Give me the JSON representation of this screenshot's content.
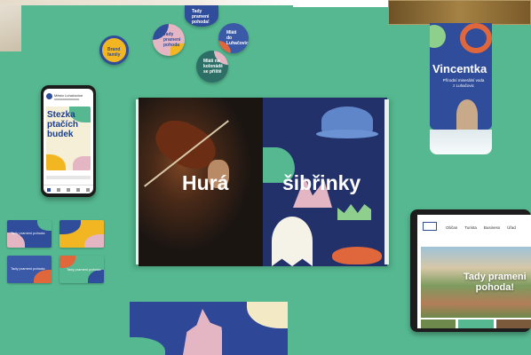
{
  "stickers": [
    {
      "text": "Brand\nfamily",
      "bg": "#f2b623"
    },
    {
      "text": "Tady\nprameni\npohoda!",
      "bg": "#2f4d9a"
    },
    {
      "text": "Tady\nprameni\npohoda",
      "bg": "#e4b6c4"
    },
    {
      "text": "Mláti\ndo\nLuhačovic",
      "bg": "#3a5aa8"
    },
    {
      "text": "Mláti na\nkolonádě\nse přiště",
      "bg": "#2d6e67"
    }
  ],
  "phone": {
    "app_header": "Město Luhačovice",
    "card_title": "Stezka\nptačích\nbudek"
  },
  "book": {
    "left_text": "Hurá",
    "right_text": "šibřinky"
  },
  "bottle": {
    "brand": "Vincentka",
    "subtitle": "Přírodní minerální voda\nz Luhačovic"
  },
  "tablet": {
    "nav": [
      "Občan",
      "Turista",
      "Business",
      "Úřad"
    ],
    "hero_text": "Tady prameni\npohoda!"
  },
  "cards": [
    {
      "text": "Tady prameni pohoda"
    },
    {
      "text": ""
    },
    {
      "text": "Tady prameni pohoda"
    },
    {
      "text": "Tady prameni pohoda"
    }
  ],
  "colors": {
    "background": "#55b890",
    "brand_blue": "#2f4d9a",
    "brand_yellow": "#f2b623",
    "brand_pink": "#e4b6c4",
    "brand_orange": "#e0663c"
  }
}
